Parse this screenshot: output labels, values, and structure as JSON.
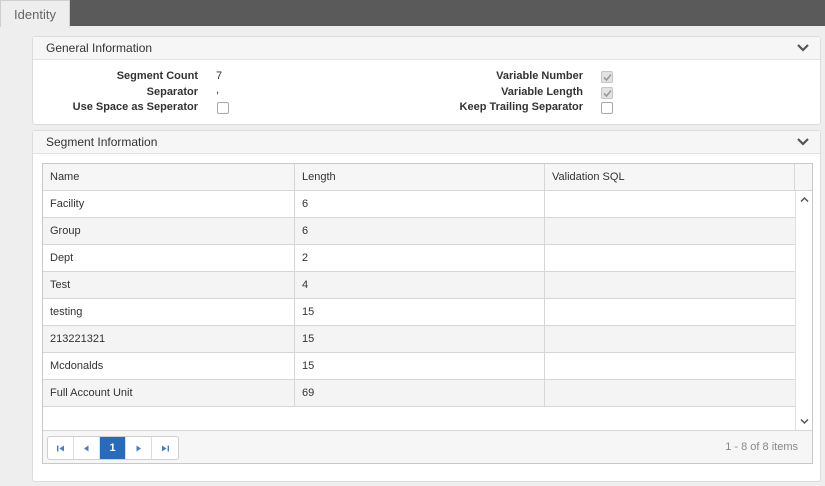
{
  "tabs": [
    {
      "label": "Identity",
      "active": true
    }
  ],
  "general": {
    "title": "General Information",
    "segment_count_label": "Segment Count",
    "segment_count_value": "7",
    "separator_label": "Separator",
    "separator_value": ",",
    "use_space_label": "Use Space as Seperator",
    "use_space_checked": false,
    "variable_number_label": "Variable Number",
    "variable_number_checked": true,
    "variable_length_label": "Variable Length",
    "variable_length_checked": true,
    "keep_trailing_label": "Keep Trailing Separator",
    "keep_trailing_checked": false
  },
  "segment": {
    "title": "Segment Information",
    "columns": [
      "Name",
      "Length",
      "Validation SQL"
    ],
    "rows": [
      [
        "Facility",
        "6",
        ""
      ],
      [
        "Group",
        "6",
        ""
      ],
      [
        "Dept",
        "2",
        ""
      ],
      [
        "Test",
        "4",
        ""
      ],
      [
        "testing",
        "15",
        ""
      ],
      [
        "213221321",
        "15",
        ""
      ],
      [
        "Mcdonalds",
        "15",
        ""
      ],
      [
        "Full Account Unit",
        "69",
        ""
      ]
    ],
    "pager": {
      "current_page": "1",
      "info": "1 - 8 of 8 items"
    }
  },
  "colors": {
    "tabbar": "#5a5a5a",
    "pager_active": "#2a6ab8",
    "alt_row": "#f4f4f4"
  }
}
